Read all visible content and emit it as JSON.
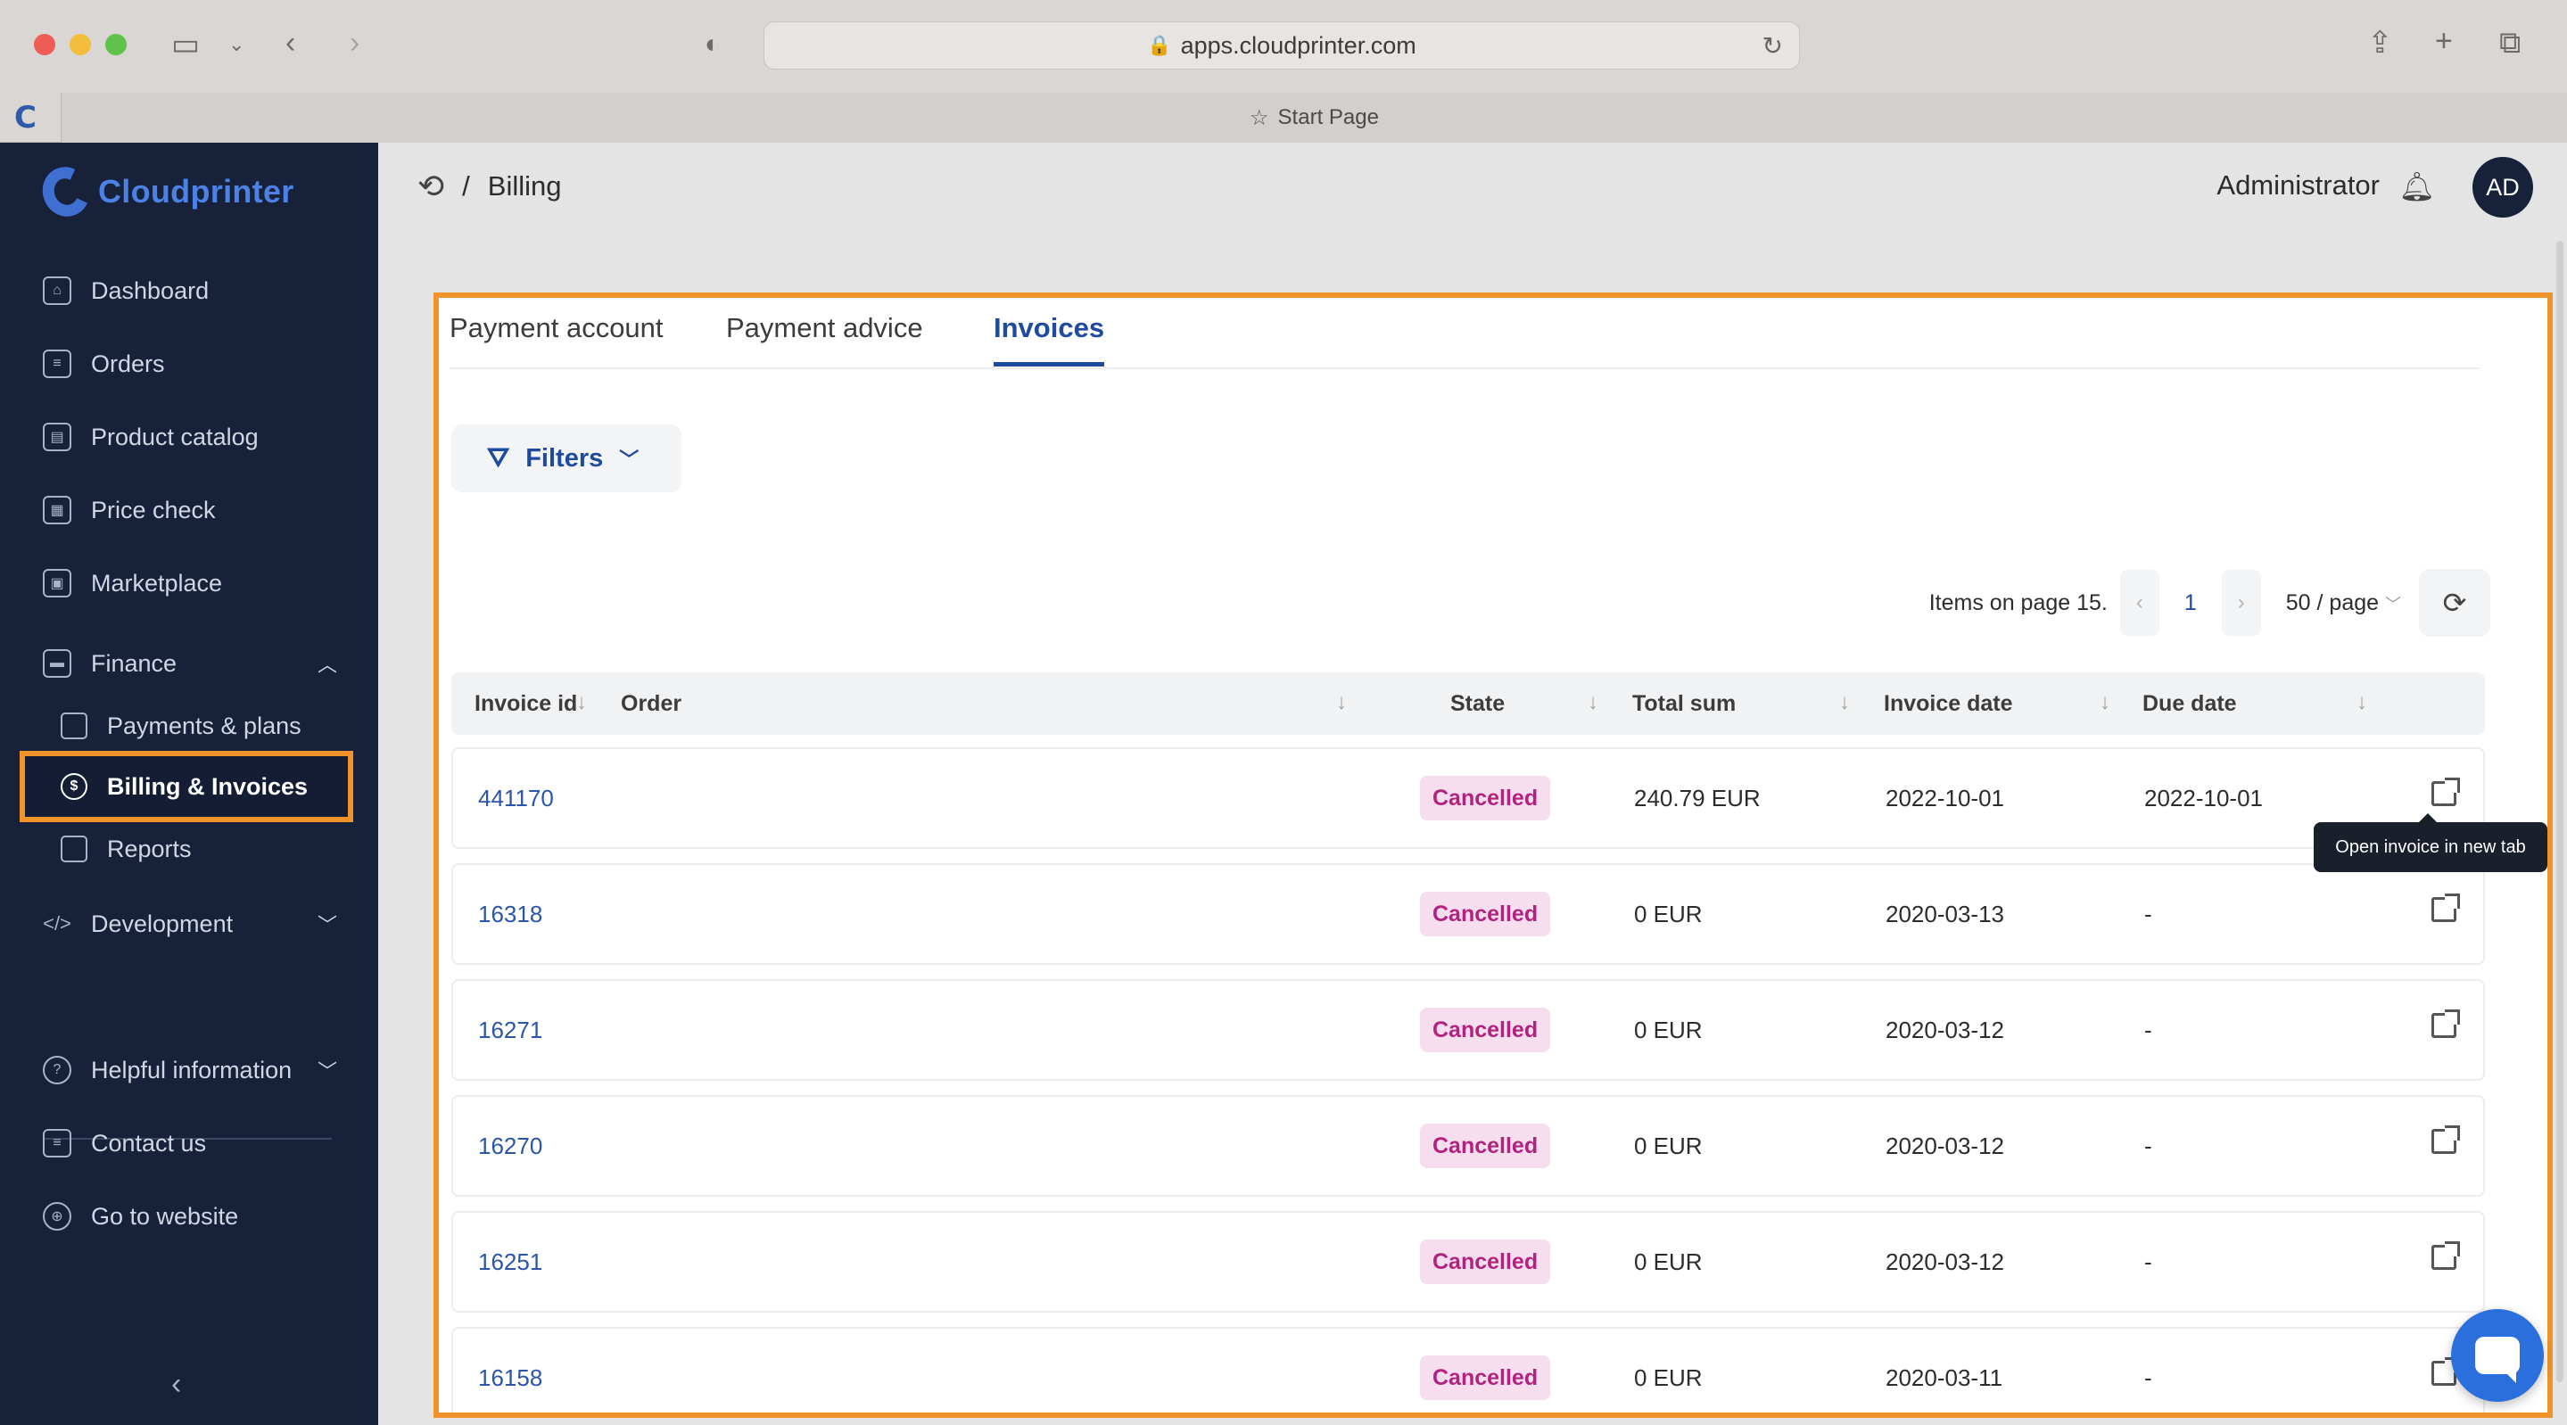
{
  "browser": {
    "url": "apps.cloudprinter.com",
    "tab_title": "Start Page",
    "favicon_letter": "C"
  },
  "sidebar": {
    "brand": "Cloudprinter",
    "items": [
      {
        "label": "Dashboard"
      },
      {
        "label": "Orders"
      },
      {
        "label": "Product catalog"
      },
      {
        "label": "Price check"
      },
      {
        "label": "Marketplace"
      },
      {
        "label": "Finance"
      },
      {
        "label": "Payments & plans"
      },
      {
        "label": "Billing & Invoices"
      },
      {
        "label": "Reports"
      },
      {
        "label": "Development"
      },
      {
        "label": "Helpful information"
      },
      {
        "label": "Contact us"
      },
      {
        "label": "Go to website"
      }
    ],
    "active_item": "Billing & Invoices"
  },
  "header": {
    "breadcrumb_sep": "/",
    "breadcrumb": "Billing",
    "user_name": "Administrator",
    "avatar_initials": "AD"
  },
  "tabs": [
    {
      "label": "Payment account"
    },
    {
      "label": "Payment advice"
    },
    {
      "label": "Invoices"
    }
  ],
  "active_tab": "Invoices",
  "filters_label": "Filters",
  "pagination": {
    "items_text": "Items on page 15.",
    "current_page": "1",
    "page_size": "50 / page"
  },
  "table": {
    "columns": [
      "Invoice id",
      "Order",
      "State",
      "Total sum",
      "Invoice date",
      "Due date"
    ],
    "rows": [
      {
        "id": "441170",
        "state": "Cancelled",
        "total": "240.79 EUR",
        "invoice_date": "2022-10-01",
        "due_date": "2022-10-01"
      },
      {
        "id": "16318",
        "state": "Cancelled",
        "total": "0 EUR",
        "invoice_date": "2020-03-13",
        "due_date": "-"
      },
      {
        "id": "16271",
        "state": "Cancelled",
        "total": "0 EUR",
        "invoice_date": "2020-03-12",
        "due_date": "-"
      },
      {
        "id": "16270",
        "state": "Cancelled",
        "total": "0 EUR",
        "invoice_date": "2020-03-12",
        "due_date": "-"
      },
      {
        "id": "16251",
        "state": "Cancelled",
        "total": "0 EUR",
        "invoice_date": "2020-03-12",
        "due_date": "-"
      },
      {
        "id": "16158",
        "state": "Cancelled",
        "total": "0 EUR",
        "invoice_date": "2020-03-11",
        "due_date": "-"
      }
    ]
  },
  "tooltip": "Open invoice in new tab",
  "colors": {
    "accent": "#1e4aa0",
    "highlight": "#f0932b",
    "sidebar_bg": "#17213a",
    "badge_text": "#b1237e",
    "badge_bg": "#f6deef"
  }
}
